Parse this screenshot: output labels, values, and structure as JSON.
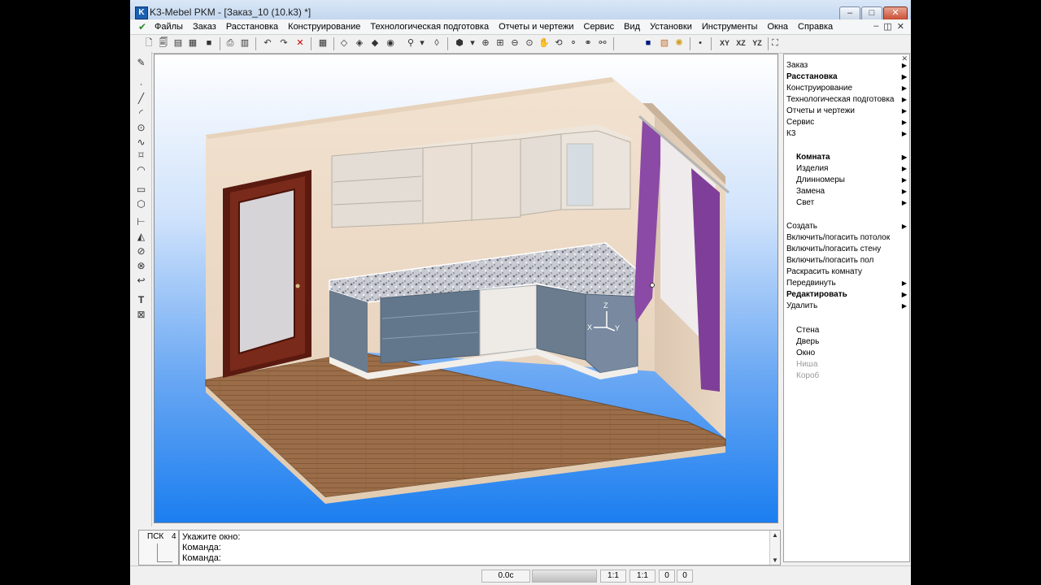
{
  "window": {
    "title": "K3-Mebel PKM - [Заказ_10 (10.k3) *]",
    "app_icon": "K"
  },
  "title_buttons": {
    "minimize": "–",
    "maximize": "□",
    "close": "✕"
  },
  "menu": {
    "items": [
      "Файлы",
      "Заказ",
      "Расстановка",
      "Конструирование",
      "Технологическая подготовка",
      "Отчеты и чертежи",
      "Сервис",
      "Вид",
      "Установки",
      "Инструменты",
      "Окна",
      "Справка"
    ],
    "mdi_controls": [
      "–",
      "◫",
      "✕"
    ]
  },
  "toolbar": {
    "icons": [
      "new-file-icon",
      "open-icon",
      "save-icon",
      "save-as-icon",
      "print-icon",
      "print-preview-icon",
      "close-doc-icon",
      "undo-icon",
      "redo-icon",
      "delete-icon",
      "grid-icon",
      "box-wire-icon",
      "box-hidden-icon",
      "box-shade-icon",
      "box-texture-icon",
      "filter-icon",
      "section-icon",
      "view-3d-icon",
      "zoom-in-icon",
      "zoom-window-icon",
      "zoom-out-icon",
      "zoom-all-icon",
      "pan-icon",
      "rotate-icon",
      "zoom-realtime-icon",
      "zoom-prev-icon",
      "zoom-extents-icon",
      "color-icon",
      "texture-icon",
      "light-icon",
      "point-icon"
    ],
    "view_labels": [
      "XY",
      "XZ",
      "YZ"
    ]
  },
  "left_tools": [
    "pencil-icon",
    "point-icon",
    "line-icon",
    "arc-icon",
    "circle-icon",
    "spline-icon",
    "polygon-icon",
    "curve-icon",
    "rectangle-icon",
    "hexagon-icon",
    "dimension-icon",
    "measure-icon",
    "hatch-icon",
    "block-icon",
    "path-icon",
    "text-icon",
    "frame-icon"
  ],
  "viewport": {
    "axes": {
      "z": "Z",
      "x": "X",
      "y": "Y"
    }
  },
  "right_panel": {
    "top_items": [
      {
        "label": "Заказ",
        "arrow": "▶",
        "bold": false
      },
      {
        "label": "Расстановка",
        "arrow": "▶",
        "bold": true
      },
      {
        "label": "Конструирование",
        "arrow": "▶",
        "bold": false
      },
      {
        "label": "Технологическая подготовка",
        "arrow": "▶",
        "bold": false
      },
      {
        "label": "Отчеты и чертежи",
        "arrow": "▶",
        "bold": false
      },
      {
        "label": "Сервис",
        "arrow": "▶",
        "bold": false
      },
      {
        "label": "К3",
        "arrow": "▶",
        "bold": false
      }
    ],
    "section1": [
      {
        "label": "Комната",
        "arrow": "▶",
        "bold": true
      },
      {
        "label": "Изделия",
        "arrow": "▶",
        "bold": false
      },
      {
        "label": "Длинномеры",
        "arrow": "▶",
        "bold": false
      },
      {
        "label": "Замена",
        "arrow": "▶",
        "bold": false
      },
      {
        "label": "Свет",
        "arrow": "▶",
        "bold": false
      }
    ],
    "section2": [
      {
        "label": "Создать",
        "arrow": "▶",
        "bold": false
      },
      {
        "label": "Включить/погасить потолок",
        "arrow": "",
        "bold": false
      },
      {
        "label": "Включить/погасить стену",
        "arrow": "",
        "bold": false
      },
      {
        "label": "Включить/погасить пол",
        "arrow": "",
        "bold": false
      },
      {
        "label": "Раскрасить комнату",
        "arrow": "",
        "bold": false
      },
      {
        "label": "Передвинуть",
        "arrow": "▶",
        "bold": false
      },
      {
        "label": "Редактировать",
        "arrow": "▶",
        "bold": true
      },
      {
        "label": "Удалить",
        "arrow": "▶",
        "bold": false
      }
    ],
    "section3": [
      {
        "label": "Стена",
        "disabled": false
      },
      {
        "label": "Дверь",
        "disabled": false
      },
      {
        "label": "Окно",
        "disabled": false
      },
      {
        "label": "Ниша",
        "disabled": true
      },
      {
        "label": "Короб",
        "disabled": true
      }
    ]
  },
  "command": {
    "psk_label": "ПСК",
    "psk_number": "4",
    "lines": [
      "Укажите окно:",
      "Команда:",
      "Команда:"
    ],
    "scroll_up": "▲",
    "scroll_down": "▼"
  },
  "status": {
    "time": "0.0c",
    "scale1": "1:1",
    "scale2": "1:1",
    "v1": "0",
    "v2": "0"
  }
}
